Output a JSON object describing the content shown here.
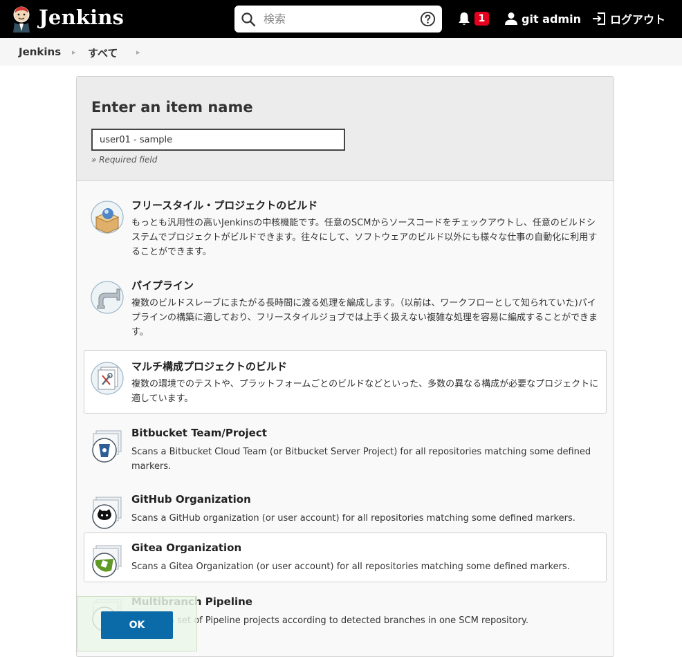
{
  "header": {
    "brand": "Jenkins",
    "search_placeholder": "検索",
    "notification_count": "1",
    "user_name": "git admin",
    "logout_label": "ログアウト"
  },
  "breadcrumb": {
    "items": [
      "Jenkins",
      "すべて"
    ]
  },
  "form": {
    "title": "Enter an item name",
    "item_name_value": "user01 - sample",
    "required_note": "» Required field"
  },
  "items": [
    {
      "title": "フリースタイル・プロジェクトのビルド",
      "description": "もっとも汎用性の高いJenkinsの中核機能です。任意のSCMからソースコードをチェックアウトし、任意のビルドシステムでプロジェクトがビルドできます。往々にして、ソフトウェアのビルド以外にも様々な仕事の自動化に利用することができます。",
      "icon": "freestyle-project-icon"
    },
    {
      "title": "パイプライン",
      "description": "複数のビルドスレーブにまたがる長時間に渡る処理を編成します。（以前は、ワークフローとして知られていた)パイプラインの構築に適しており、フリースタイルジョブでは上手く扱えない複雑な処理を容易に編成することができます。",
      "icon": "pipeline-icon"
    },
    {
      "title": "マルチ構成プロジェクトのビルド",
      "description": "複数の環境でのテストや、プラットフォームごとのビルドなどといった、多数の異なる構成が必要なプロジェクトに適しています。",
      "icon": "multi-config-project-icon"
    },
    {
      "title": "Bitbucket Team/Project",
      "description": "Scans a Bitbucket Cloud Team (or Bitbucket Server Project) for all repositories matching some defined markers.",
      "icon": "bitbucket-icon"
    },
    {
      "title": "GitHub Organization",
      "description": "Scans a GitHub organization (or user account) for all repositories matching some defined markers.",
      "icon": "github-icon"
    },
    {
      "title": "Gitea Organization",
      "description": "Scans a Gitea Organization (or user account) for all repositories matching some defined markers.",
      "icon": "gitea-icon"
    },
    {
      "title": "Multibranch Pipeline",
      "description": "Creates a set of Pipeline projects according to detected branches in one SCM repository.",
      "icon": "multibranch-pipeline-icon"
    }
  ],
  "ok_label": "OK",
  "colors": {
    "header_bg": "#000000",
    "badge": "#e6001f",
    "ok_button": "#0b6aa8"
  }
}
